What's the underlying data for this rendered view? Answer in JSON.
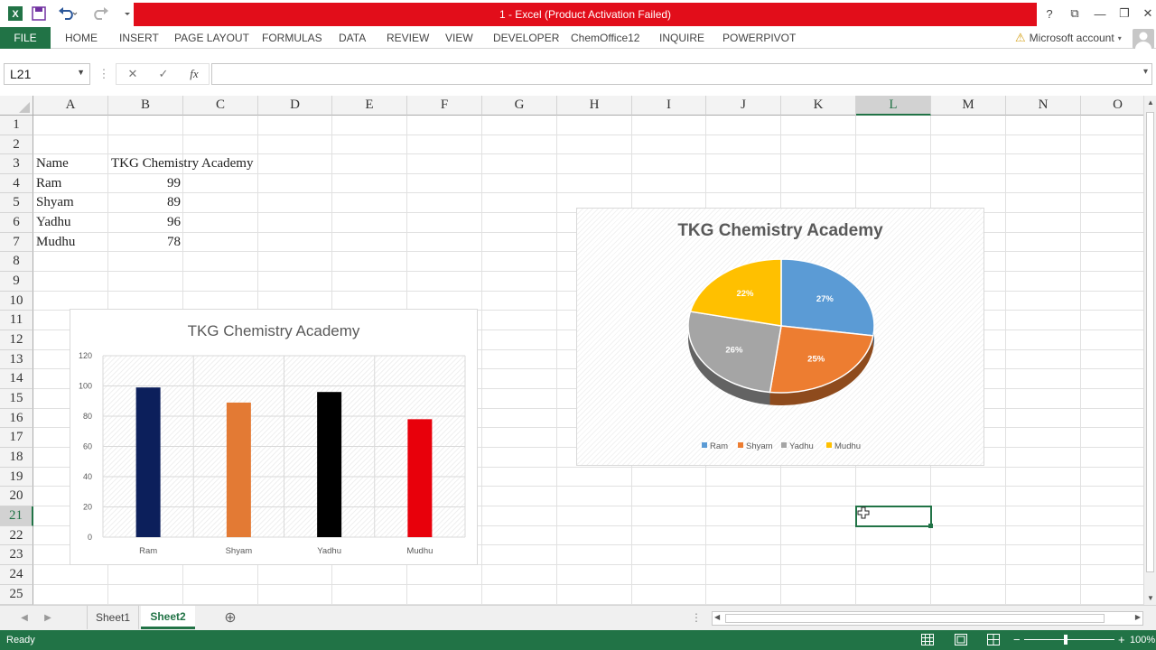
{
  "titlebar": {
    "title": "1 -  Excel (Product Activation Failed)",
    "help": "?",
    "ribbon_display": "⧉",
    "minimize": "—",
    "restore": "❐",
    "close": "✕"
  },
  "ribbon": {
    "file": "FILE",
    "tabs": [
      "HOME",
      "INSERT",
      "PAGE LAYOUT",
      "FORMULAS",
      "DATA",
      "REVIEW",
      "VIEW",
      "DEVELOPER",
      "ChemOffice12",
      "INQUIRE",
      "POWERPIVOT"
    ],
    "account": "Microsoft account"
  },
  "formula_bar": {
    "name_box": "L21",
    "fx": "fx",
    "formula": ""
  },
  "grid": {
    "columns": [
      "A",
      "B",
      "C",
      "D",
      "E",
      "F",
      "G",
      "H",
      "I",
      "J",
      "K",
      "L",
      "M",
      "N",
      "O"
    ],
    "rows": [
      "1",
      "2",
      "3",
      "4",
      "5",
      "6",
      "7",
      "8",
      "9",
      "10",
      "11",
      "12",
      "13",
      "14",
      "15",
      "16",
      "17",
      "18",
      "19",
      "20",
      "21",
      "22",
      "23",
      "24",
      "25"
    ],
    "cells": {
      "a3": "Name",
      "b3": "TKG Chemistry Academy",
      "a4": "Ram",
      "b4": "99",
      "a5": "Shyam",
      "b5": "89",
      "a6": "Yadhu",
      "b6": "96",
      "a7": "Mudhu",
      "b7": "78"
    }
  },
  "chart_data": [
    {
      "type": "bar",
      "title": "TKG Chemistry Academy",
      "categories": [
        "Ram",
        "Shyam",
        "Yadhu",
        "Mudhu"
      ],
      "values": [
        99,
        89,
        96,
        78
      ],
      "bar_colors": [
        "#0c1f5b",
        "#e37a34",
        "#000000",
        "#e8000b"
      ],
      "yticks": [
        "0",
        "20",
        "40",
        "60",
        "80",
        "100",
        "120"
      ],
      "ylim": [
        0,
        120
      ],
      "grid": true
    },
    {
      "type": "pie",
      "title": "TKG Chemistry Academy",
      "labels": [
        "Ram",
        "Shyam",
        "Yadhu",
        "Mudhu"
      ],
      "values": [
        99,
        89,
        96,
        78
      ],
      "percent_labels": [
        "27%",
        "25%",
        "26%",
        "22%"
      ],
      "colors": [
        "#5b9bd5",
        "#ed7d31",
        "#a5a5a5",
        "#ffc000"
      ],
      "legend": "bottom"
    }
  ],
  "sheets": {
    "tabs": [
      "Sheet1",
      "Sheet2"
    ],
    "active": "Sheet2",
    "add": "⊕"
  },
  "status": {
    "ready": "Ready",
    "zoom": "100%"
  },
  "colors": {
    "excel_green": "#217346",
    "title_red": "#e20d1a"
  }
}
